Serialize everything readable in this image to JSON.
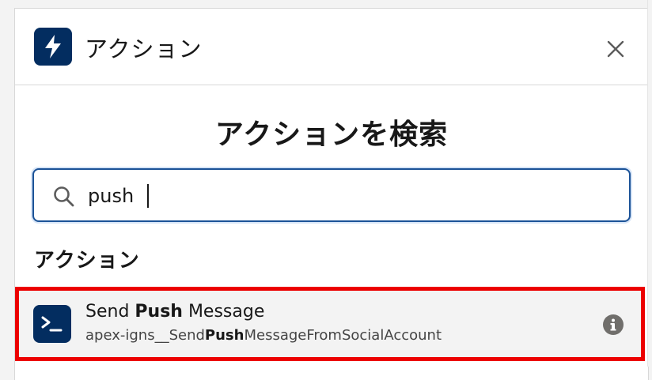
{
  "header": {
    "icon": "lightning-bolt-icon",
    "title": "アクション",
    "close_icon": "close-icon"
  },
  "search": {
    "heading": "アクションを検索",
    "value": "push",
    "placeholder": ""
  },
  "results": {
    "section_label": "アクション",
    "items": [
      {
        "icon": "apex-terminal-icon",
        "title_pre": "Send ",
        "title_bold": "Push",
        "title_post": " Message",
        "sub_pre": "apex-igns__Send",
        "sub_bold": "Push",
        "sub_post": "MessageFromSocialAccount",
        "info_icon": "info-icon",
        "highlighted": true
      }
    ]
  },
  "colors": {
    "brand": "#032d60",
    "focus_border": "#1b5297",
    "highlight": "#ec0000"
  }
}
